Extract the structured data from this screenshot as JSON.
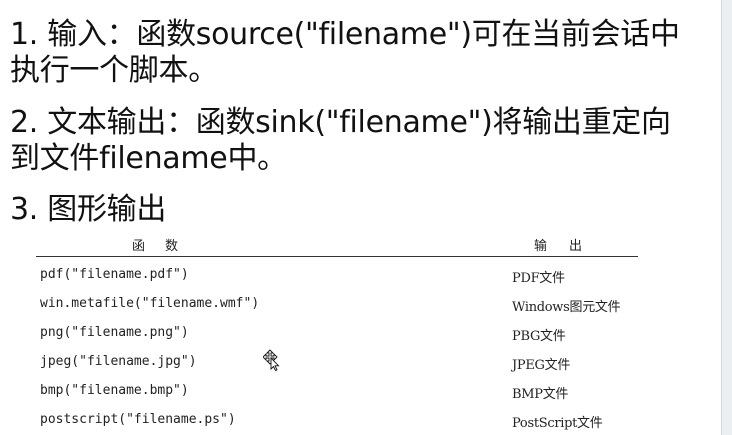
{
  "items": [
    {
      "number": "1.",
      "heading": "输入：",
      "text": "函数source(\"filename\")可在当前会话中执行一个脚本。"
    },
    {
      "number": "2.",
      "heading": "文本输出：",
      "text": "函数sink(\"filename\")将输出重定向到文件filename中。"
    },
    {
      "number": "3.",
      "heading": "图形输出",
      "text": ""
    }
  ],
  "table": {
    "headers": {
      "function": "函数",
      "output": "输出"
    },
    "rows": [
      {
        "function": "pdf(\"filename.pdf\")",
        "output": "PDF文件"
      },
      {
        "function": "win.metafile(\"filename.wmf\")",
        "output": "Windows图元文件"
      },
      {
        "function": "png(\"filename.png\")",
        "output": "PBG文件"
      },
      {
        "function": "jpeg(\"filename.jpg\")",
        "output": "JPEG文件"
      },
      {
        "function": "bmp(\"filename.bmp\")",
        "output": "BMP文件"
      },
      {
        "function": "postscript(\"filename.ps\")",
        "output": "PostScript文件"
      }
    ]
  },
  "icons": {
    "cursor": "move-cursor-icon"
  }
}
